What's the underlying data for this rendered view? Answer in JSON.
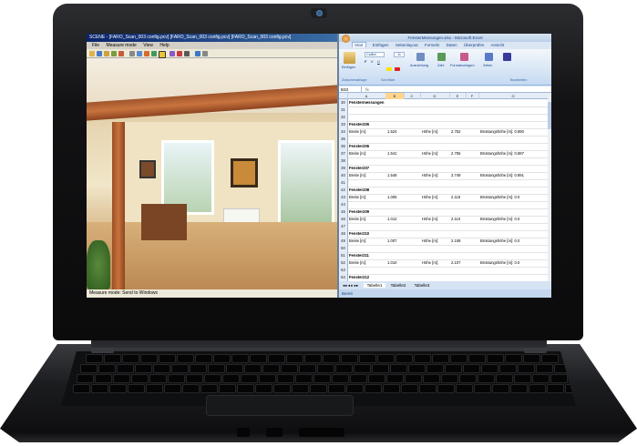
{
  "faro": {
    "title": "SCENE - [FARO_Scan_003 config.pcv]   [FARO_Scan_003 config.pcv]   [FARO_Scan_003 config.pcv]",
    "menu": [
      "File",
      "Measure mode",
      "View",
      "Help"
    ],
    "status": "Measure mode: Send to Windows"
  },
  "excel": {
    "title": "FensterMessungen.xlsx - Microsoft Excel",
    "tabs": [
      "Start",
      "Einfügen",
      "Seitenlayout",
      "Formeln",
      "Daten",
      "Überprüfen",
      "Ansicht"
    ],
    "ribbon": {
      "paste": "Einfügen",
      "font_name": "Calibri",
      "font_size": "11",
      "align": "Ausrichtung",
      "number": "Zahl",
      "styles": "Formatvorlagen",
      "cells": "Zellen",
      "edit": "Bearbeiten",
      "group_clipboard": "Zwischenablage",
      "group_font": "Schriftart"
    },
    "name_box": "B33",
    "fx": "fx",
    "columns": [
      "A",
      "B",
      "C",
      "D",
      "E",
      "F",
      "G"
    ],
    "selected_column": "B",
    "rows": [
      {
        "n": "30",
        "a": "Fenstermessungen",
        "bold": true
      },
      {
        "n": "31"
      },
      {
        "n": "32"
      },
      {
        "n": "33",
        "a": "Fenster205",
        "bold": true
      },
      {
        "n": "34",
        "a": "Breite [m]:",
        "b": "1.524",
        "d": "Höhe [m]:",
        "e": "2.752",
        "g": "Brüstungshöhe [m]: 0.890"
      },
      {
        "n": "35"
      },
      {
        "n": "36",
        "a": "Fenster206",
        "bold": true
      },
      {
        "n": "37",
        "a": "Breite [m]:",
        "b": "1.541",
        "d": "Höhe [m]:",
        "e": "2.755",
        "g": "Brüstungshöhe [m]: 0.887"
      },
      {
        "n": "38"
      },
      {
        "n": "39",
        "a": "Fenster207",
        "bold": true
      },
      {
        "n": "40",
        "a": "Breite [m]:",
        "b": "1.548",
        "d": "Höhe [m]:",
        "e": "2.749",
        "g": "Brüstungshöhe [m]: 0.891"
      },
      {
        "n": "41"
      },
      {
        "n": "42",
        "a": "Fenster208",
        "bold": true
      },
      {
        "n": "43",
        "a": "Breite [m]:",
        "b": "1.005",
        "d": "Höhe [m]:",
        "e": "2.115",
        "g": "Brüstungshöhe [m]: 0.0"
      },
      {
        "n": "44"
      },
      {
        "n": "45",
        "a": "Fenster209",
        "bold": true
      },
      {
        "n": "46",
        "a": "Breite [m]:",
        "b": "1.012",
        "d": "Höhe [m]:",
        "e": "2.110",
        "g": "Brüstungshöhe [m]: 0.0"
      },
      {
        "n": "47"
      },
      {
        "n": "48",
        "a": "Fenster210",
        "bold": true
      },
      {
        "n": "49",
        "a": "Breite [m]:",
        "b": "1.007",
        "d": "Höhe [m]:",
        "e": "2.108",
        "g": "Brüstungshöhe [m]: 0.0"
      },
      {
        "n": "50"
      },
      {
        "n": "51",
        "a": "Fenster211",
        "bold": true
      },
      {
        "n": "52",
        "a": "Breite [m]:",
        "b": "1.010",
        "d": "Höhe [m]:",
        "e": "2.107",
        "g": "Brüstungshöhe [m]: 0.0"
      },
      {
        "n": "53"
      },
      {
        "n": "54",
        "a": "Fenster212",
        "bold": true
      }
    ],
    "sheets": [
      "Tabelle1",
      "Tabelle2",
      "Tabelle3"
    ],
    "status": "Bereit"
  }
}
